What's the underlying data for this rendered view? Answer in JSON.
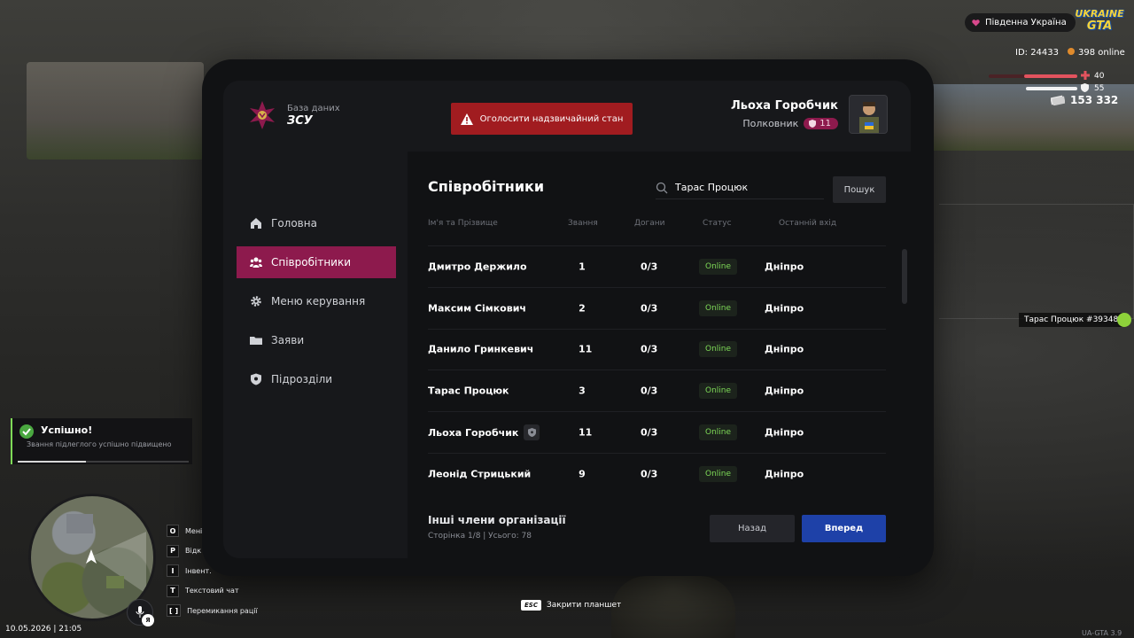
{
  "header": {
    "brand_sub": "База даних",
    "brand_name": "ЗСУ",
    "alert_label": "Оголосити надзвичайний стан",
    "user_name": "Льоха Горобчик",
    "user_rank": "Полковник",
    "user_rank_level": "11"
  },
  "sidebar": {
    "items": [
      {
        "label": "Головна",
        "icon": "home-icon",
        "active": false
      },
      {
        "label": "Співробітники",
        "icon": "users-icon",
        "active": true
      },
      {
        "label": "Меню керування",
        "icon": "gear-icon",
        "active": false
      },
      {
        "label": "Заяви",
        "icon": "folder-icon",
        "active": false
      },
      {
        "label": "Підрозділи",
        "icon": "shield-icon",
        "active": false
      }
    ]
  },
  "main": {
    "title": "Співробітники",
    "search_value": "Тарас Процюк",
    "search_button": "Пошук",
    "columns": [
      "Ім'я та Прізвище",
      "Звання",
      "Догани",
      "Статус",
      "Останній вхід"
    ],
    "rows": [
      {
        "name": "Дмитро Держило",
        "rank": "1",
        "warns": "0/3",
        "status": "Online",
        "last": "Дніпро",
        "leader": false
      },
      {
        "name": "Максим Сімкович",
        "rank": "2",
        "warns": "0/3",
        "status": "Online",
        "last": "Дніпро",
        "leader": false
      },
      {
        "name": "Данило Гринкевич",
        "rank": "11",
        "warns": "0/3",
        "status": "Online",
        "last": "Дніпро",
        "leader": false
      },
      {
        "name": "Тарас Процюк",
        "rank": "3",
        "warns": "0/3",
        "status": "Online",
        "last": "Дніпро",
        "leader": false
      },
      {
        "name": "Льоха Горобчик",
        "rank": "11",
        "warns": "0/3",
        "status": "Online",
        "last": "Дніпро",
        "leader": true
      },
      {
        "name": "Леонід Стрицький",
        "rank": "9",
        "warns": "0/3",
        "status": "Online",
        "last": "Дніпро",
        "leader": false
      }
    ],
    "footer_title": "Інші члени організації",
    "footer_meta": "Сторінка 1/8 | Усього: 78",
    "back_label": "Назад",
    "next_label": "Вперед"
  },
  "hud": {
    "server": "Південна Україна",
    "logo_top": "UKRAINE",
    "logo_bottom": "GTA",
    "player_id": "ID: 24433",
    "online": "398 online",
    "health": "40",
    "armor": "55",
    "money": "153 332",
    "player_tag": "Тарас Процюк #39348",
    "datetime": "10.05.2026 | 21:05",
    "version": "UA-GTA 3.9",
    "lang": "Я",
    "esc_key": "ESC",
    "esc_label": "Закрити планшет"
  },
  "toast": {
    "title": "Успішно!",
    "message": "Звання підлеглого успішно підвищено",
    "progress": 0.4
  },
  "keybinds": [
    {
      "key": "O",
      "label": "Мені"
    },
    {
      "key": "P",
      "label": "Відк"
    },
    {
      "key": "I",
      "label": "Інвент."
    },
    {
      "key": "T",
      "label": "Текстовий чат"
    },
    {
      "key": "[ ]",
      "label": "Перемикання рації"
    }
  ],
  "colors": {
    "accent": "#8d1a4d",
    "alert": "#a11c20",
    "primary": "#1e41a8",
    "online": "#7ed957"
  }
}
